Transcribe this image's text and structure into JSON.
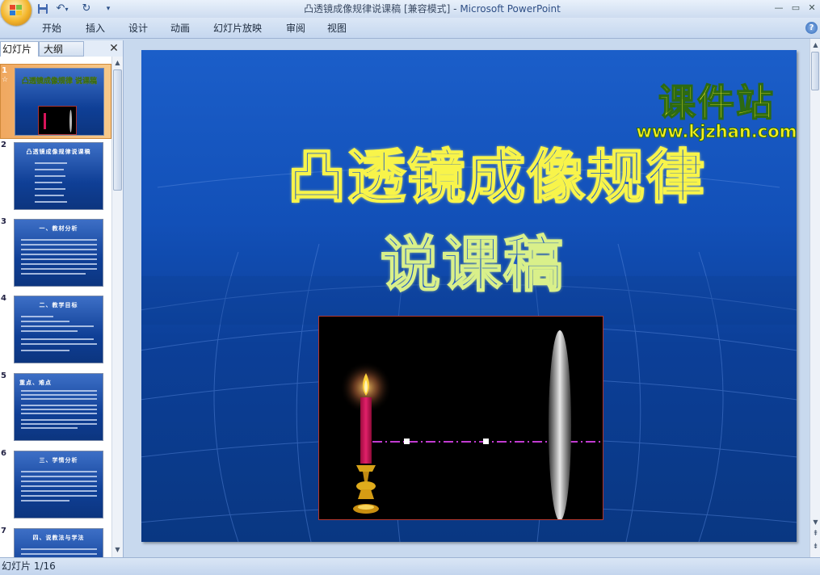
{
  "window": {
    "title": "凸透镜成像规律说课稿 [兼容模式] - ",
    "app_name": "Microsoft PowerPoint",
    "controls": [
      "—",
      "▭",
      "✕"
    ]
  },
  "quick_access": {
    "icons": [
      "save-icon",
      "undo-icon",
      "redo-icon",
      "customize-icon"
    ]
  },
  "ribbon": {
    "tabs": [
      "开始",
      "插入",
      "设计",
      "动画",
      "幻灯片放映",
      "审阅",
      "视图"
    ],
    "help_label": "?"
  },
  "panel": {
    "tab_slides": "幻灯片",
    "tab_outline": "大纲",
    "close_label": "✕",
    "thumbnails": [
      {
        "number": "1",
        "title": "凸透镜成像规律 说课稿",
        "selected": true,
        "animation_star": "☆"
      },
      {
        "number": "2",
        "title": "凸透镜成像规律说课稿"
      },
      {
        "number": "3",
        "title": "一、教材分析"
      },
      {
        "number": "4",
        "title": "二、教学目标"
      },
      {
        "number": "5",
        "title": "重点、难点"
      },
      {
        "number": "6",
        "title": "三、学情分析"
      },
      {
        "number": "7",
        "title": "四、说教法与学法"
      }
    ]
  },
  "slide": {
    "title_line1": "凸透镜成像规律",
    "title_line2": "说课稿",
    "watermark_cn": "课件站",
    "watermark_url": "www.kjzhan.com",
    "colors": {
      "background_top": "#1b5ec9",
      "background_bottom": "#093782",
      "title_outline": "#f8f44a",
      "title2_outline": "#d9f08a",
      "candle": "#d8145a",
      "axis_line": "#c23bd1"
    }
  },
  "status": {
    "slide_indicator": "幻灯片 1/16"
  }
}
